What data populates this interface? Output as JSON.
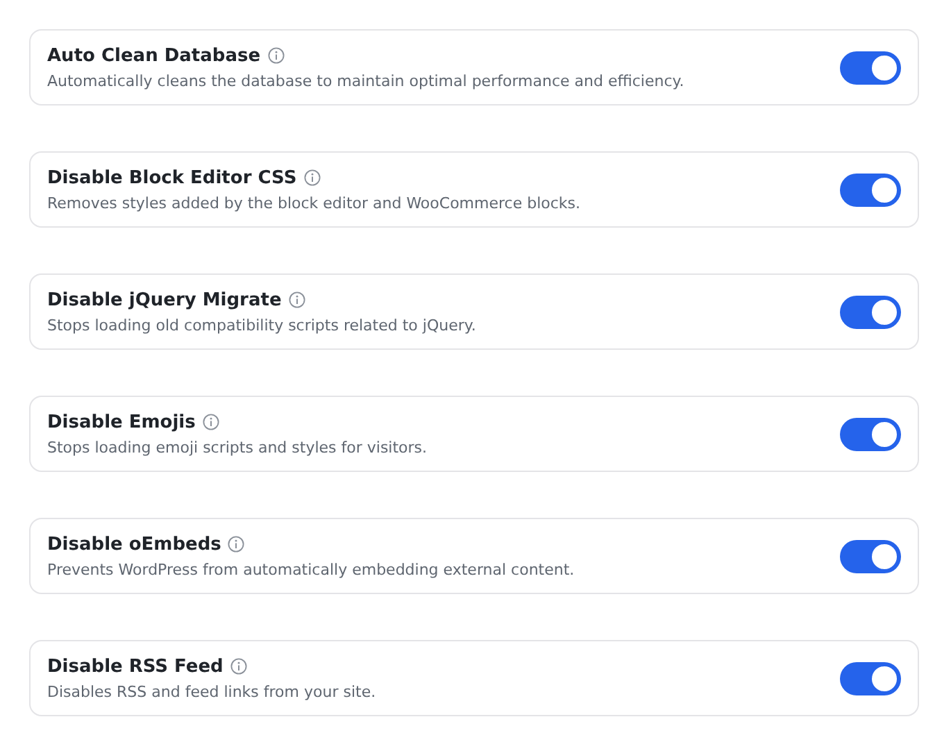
{
  "settings": [
    {
      "title": "Auto Clean Database",
      "description": "Automatically cleans the database to maintain optimal performance and efficiency.",
      "on": true
    },
    {
      "title": "Disable Block Editor CSS",
      "description": "Removes styles added by the block editor and WooCommerce blocks.",
      "on": true
    },
    {
      "title": "Disable jQuery Migrate",
      "description": "Stops loading old compatibility scripts related to jQuery.",
      "on": true
    },
    {
      "title": "Disable Emojis",
      "description": "Stops loading emoji scripts and styles for visitors.",
      "on": true
    },
    {
      "title": "Disable oEmbeds",
      "description": "Prevents WordPress from automatically embedding external content.",
      "on": true
    },
    {
      "title": "Disable RSS Feed",
      "description": "Disables RSS and feed links from your site.",
      "on": true
    }
  ]
}
